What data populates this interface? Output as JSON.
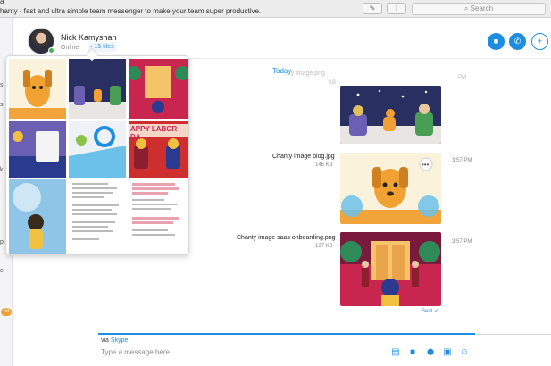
{
  "topbar": {
    "title_fragment": "a",
    "subtitle": "hanty - fast and ultra simple team messenger to make your team super productive.",
    "search_placeholder": "Search",
    "search_icon_glyph": "⌕"
  },
  "sidebar": {
    "fragments": [
      "si",
      "s",
      "k",
      "pi",
      "e"
    ],
    "badge": "58"
  },
  "contact": {
    "name": "Nick Kamyshan",
    "status": "Online",
    "files_label": "15 files",
    "online_color": "#4caf50"
  },
  "header_actions": [
    {
      "name": "video-call-button",
      "icon": "video-icon",
      "glyph": "■"
    },
    {
      "name": "audio-call-button",
      "icon": "phone-icon",
      "glyph": "✆"
    },
    {
      "name": "add-people-button",
      "icon": "add-person-icon",
      "glyph": "+"
    }
  ],
  "chat": {
    "day_divider": "Today",
    "messages": [
      {
        "title": "Chanty image blog.jpg",
        "size": "146 KB",
        "time": "3:57 PM"
      },
      {
        "title": "Chanty image saas onboarding.png",
        "size": "137 KB",
        "time": "3:57 PM"
      }
    ],
    "top_message_partial": {
      "title": "...ty image.png",
      "size": "KB",
      "time": "PM"
    },
    "sent_label": "Sent ✓"
  },
  "popover": {
    "thumbnails": [
      {
        "name": "thumb-dog-orange"
      },
      {
        "name": "thumb-night-scene"
      },
      {
        "name": "thumb-hotel-doormen"
      },
      {
        "name": "thumb-bird-tablet"
      },
      {
        "name": "thumb-phone-scene"
      },
      {
        "name": "thumb-labor-day",
        "text": "APPY LABOR DA"
      },
      {
        "name": "thumb-girl-clock"
      },
      {
        "name": "thumb-doc-text"
      },
      {
        "name": "thumb-doc-pink"
      }
    ]
  },
  "composer": {
    "via_prefix": "via",
    "via_service": "Skype",
    "placeholder": "Type a message here",
    "actions": [
      {
        "name": "attach-file-button",
        "icon": "file-icon",
        "glyph": "▤"
      },
      {
        "name": "send-video-button",
        "icon": "video-icon",
        "glyph": "■"
      },
      {
        "name": "send-location-button",
        "icon": "location-icon",
        "glyph": "⬤"
      },
      {
        "name": "send-contact-button",
        "icon": "contact-card-icon",
        "glyph": "▣"
      },
      {
        "name": "emoji-button",
        "icon": "emoji-icon",
        "glyph": "☺"
      }
    ]
  },
  "colors": {
    "accent": "#1c8de0",
    "badge": "#f0a035"
  }
}
